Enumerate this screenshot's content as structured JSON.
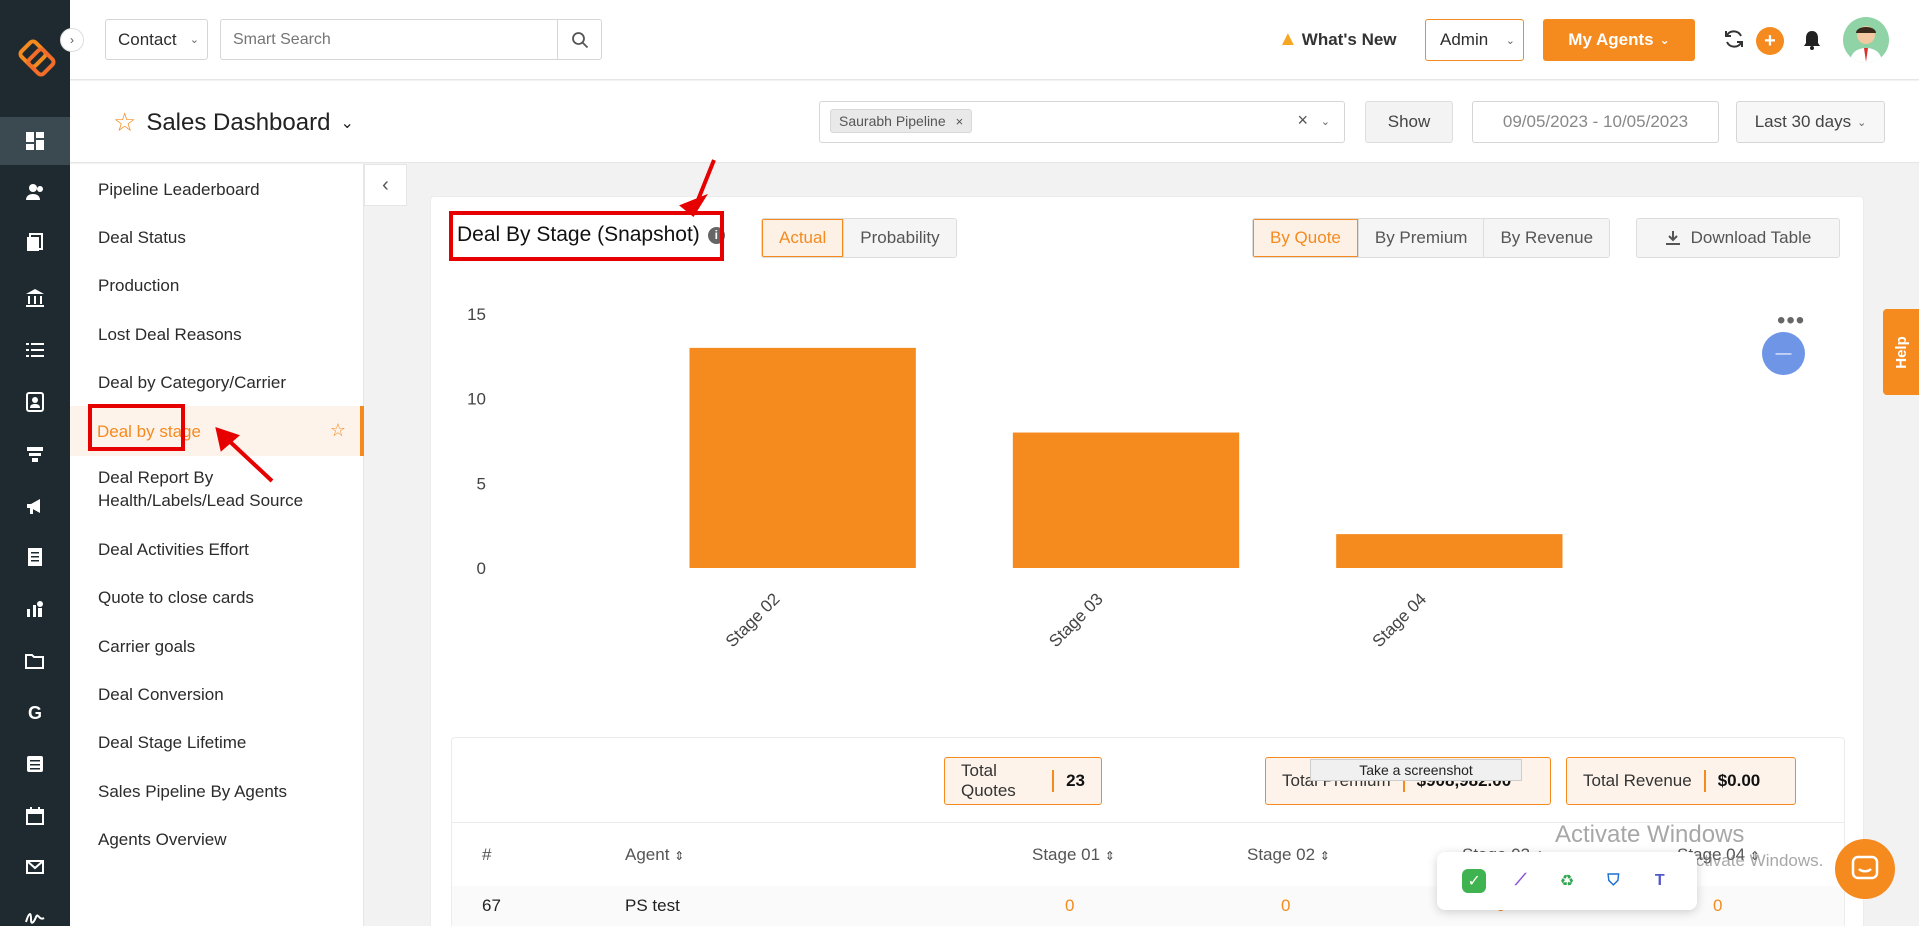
{
  "topbar": {
    "entity_select": "Contact",
    "search_placeholder": "Smart Search",
    "whats_new": "What's New",
    "role_select": "Admin",
    "agents_button": "My Agents"
  },
  "subheader": {
    "title": "Sales Dashboard",
    "pipeline_tag": "Saurabh Pipeline",
    "show_button": "Show",
    "date_range": "09/05/2023 - 10/05/2023",
    "period": "Last 30 days"
  },
  "reports_nav": {
    "items": [
      {
        "label": "Pipeline Leaderboard"
      },
      {
        "label": "Deal Status"
      },
      {
        "label": "Production"
      },
      {
        "label": "Lost Deal Reasons"
      },
      {
        "label": "Deal by Category/Carrier"
      },
      {
        "label": "Deal by stage"
      },
      {
        "label": "Deal Report By Health/Labels/Lead Source"
      },
      {
        "label": "Deal Activities Effort"
      },
      {
        "label": "Quote to close cards"
      },
      {
        "label": "Carrier goals"
      },
      {
        "label": "Deal Conversion"
      },
      {
        "label": "Deal Stage Lifetime"
      },
      {
        "label": "Sales Pipeline By Agents"
      },
      {
        "label": "Agents Overview"
      }
    ],
    "active_index": 5
  },
  "card": {
    "title": "Deal By Stage (Snapshot)",
    "mode_tabs": [
      "Actual",
      "Probability"
    ],
    "metric_tabs": [
      "By Quote",
      "By Premium",
      "By Revenue"
    ],
    "download_button": "Download Table"
  },
  "chart_data": {
    "type": "bar",
    "categories": [
      "Stage 02",
      "Stage 03",
      "Stage 04"
    ],
    "values": [
      13,
      8,
      2
    ],
    "ylim": [
      0,
      15
    ],
    "yticks": [
      0,
      5,
      10,
      15
    ],
    "color": "#f58a1f",
    "title": "",
    "xlabel": "",
    "ylabel": ""
  },
  "totals": {
    "quotes_label": "Total Quotes",
    "quotes_value": "23",
    "premium_label": "Total Premium",
    "premium_value": "$908,982.00",
    "revenue_label": "Total Revenue",
    "revenue_value": "$0.00"
  },
  "table": {
    "headers": [
      "#",
      "Agent",
      "Stage 01",
      "Stage 02",
      "Stage 03",
      "Stage 04"
    ],
    "rows": [
      {
        "id": "67",
        "agent": "PS test",
        "stage01": "0",
        "stage02": "0",
        "stage03": "0",
        "stage04": "0"
      }
    ]
  },
  "overlays": {
    "screenshot_tooltip": "Take a screenshot",
    "help_tab": "Help",
    "watermark_line1": "Activate Windows",
    "watermark_line2": "Go to Settings to activate Windows."
  },
  "colors": {
    "accent": "#f58a1f",
    "rail": "#1e2a2f",
    "annotation": "#e60000"
  }
}
